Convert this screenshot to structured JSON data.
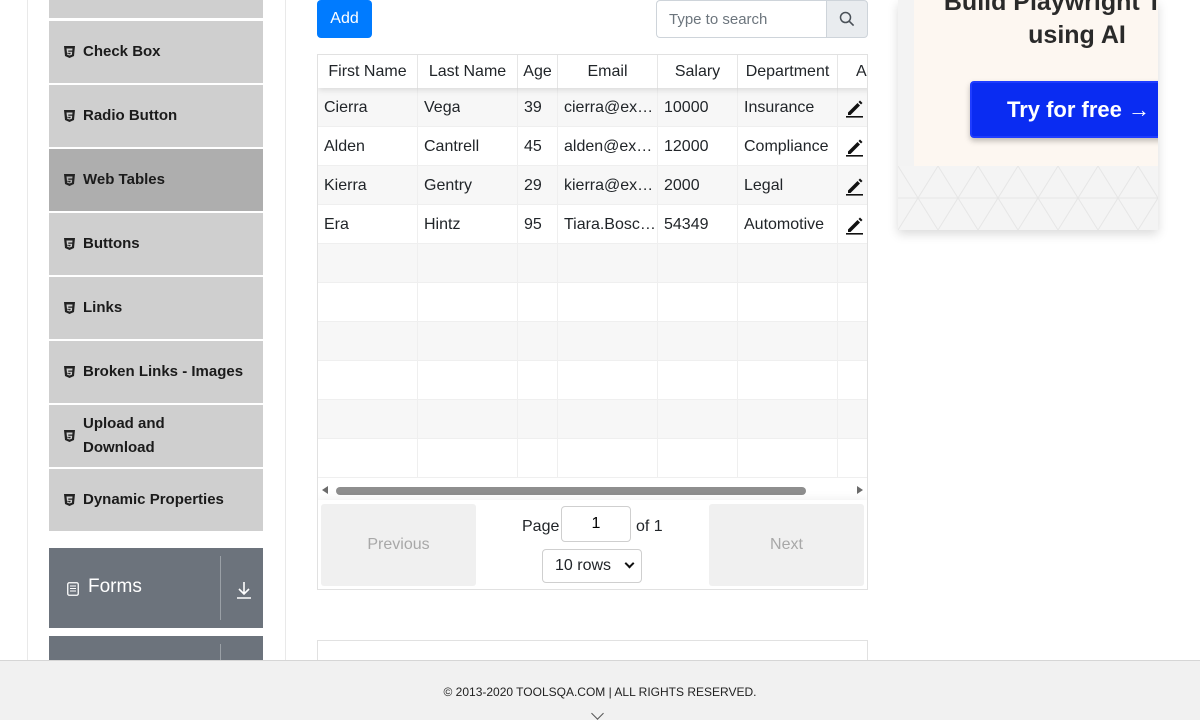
{
  "sidebar": {
    "items": [
      {
        "label": ""
      },
      {
        "label": "Check Box"
      },
      {
        "label": "Radio Button"
      },
      {
        "label": "Web Tables"
      },
      {
        "label": "Buttons"
      },
      {
        "label": "Links"
      },
      {
        "label": "Broken Links - Images"
      },
      {
        "label": "Upload and Download"
      },
      {
        "label": "Dynamic Properties"
      }
    ],
    "active_item": "Web Tables",
    "groups": [
      {
        "label": "Forms"
      },
      {
        "label": ""
      }
    ]
  },
  "toolbar": {
    "add_label": "Add",
    "search_placeholder": "Type to search"
  },
  "table": {
    "columns": [
      "First Name",
      "Last Name",
      "Age",
      "Email",
      "Salary",
      "Department",
      "Action"
    ],
    "rows": [
      [
        "Cierra",
        "Vega",
        "39",
        "cierra@example.com",
        "10000",
        "Insurance"
      ],
      [
        "Alden",
        "Cantrell",
        "45",
        "alden@example.com",
        "12000",
        "Compliance"
      ],
      [
        "Kierra",
        "Gentry",
        "29",
        "kierra@example.com",
        "2000",
        "Legal"
      ],
      [
        "Era",
        "Hintz",
        "95",
        "Tiara.Bosco@example.com",
        "54349",
        "Automotive"
      ]
    ],
    "empty_rows": 6,
    "edit_icon": "edit-icon"
  },
  "pagination": {
    "previous_label": "Previous",
    "next_label": "Next",
    "page_label": "Page",
    "page_value": "1",
    "of_label": "of 1",
    "rows_option": "10 rows"
  },
  "ad": {
    "headline": "Build Playwright Tests using AI",
    "cta": "Try for free →",
    "cta_color": "#0a2cf2"
  },
  "footer": {
    "copyright": "© 2013-2020 TOOLSQA.COM | ALL RIGHTS RESERVED."
  },
  "colors": {
    "accent": "#007bff",
    "sidebar_item": "#cfcfcf",
    "sidebar_active": "#aeaeae",
    "group_bg": "#6c737c"
  }
}
